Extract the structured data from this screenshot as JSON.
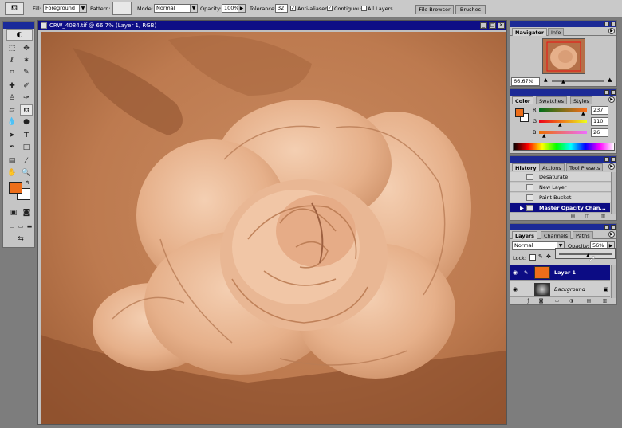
{
  "options_bar": {
    "fill_label": "Fill:",
    "fill_value": "Foreground",
    "pattern_label": "Pattern:",
    "mode_label": "Mode:",
    "mode_value": "Normal",
    "opacity_label": "Opacity:",
    "opacity_value": "100%",
    "tolerance_label": "Tolerance:",
    "tolerance_value": "32",
    "anti_aliased_label": "Anti-aliased",
    "contiguous_label": "Contiguous",
    "all_layers_label": "All Layers",
    "file_browser_label": "File Browser",
    "brushes_label": "Brushes"
  },
  "document": {
    "title": "CRW_4084.tif @ 66.7% (Layer 1, RGB)"
  },
  "navigator": {
    "tabs": [
      "Navigator",
      "Info"
    ],
    "zoom": "66.67%"
  },
  "color": {
    "tabs": [
      "Color",
      "Swatches",
      "Styles"
    ],
    "r_label": "R",
    "g_label": "G",
    "b_label": "B",
    "r_value": "237",
    "g_value": "110",
    "b_value": "26",
    "foreground_color": "#ed6e1a",
    "background_color": "#ffffff"
  },
  "history": {
    "tabs": [
      "History",
      "Actions",
      "Tool Presets"
    ],
    "items": [
      "Desaturate",
      "New Layer",
      "Paint Bucket",
      "Master Opacity Chan..."
    ]
  },
  "layers": {
    "tabs": [
      "Layers",
      "Channels",
      "Paths"
    ],
    "blend_mode": "Normal",
    "opacity_label": "Opacity:",
    "opacity_value": "56%",
    "lock_label": "Lock:",
    "rows": [
      {
        "name": "Layer 1"
      },
      {
        "name": "Background"
      }
    ]
  },
  "colors": {
    "title_bar": "#0e0e86",
    "canvas_tone": "#c5845a",
    "selection": "#0c0c84"
  }
}
